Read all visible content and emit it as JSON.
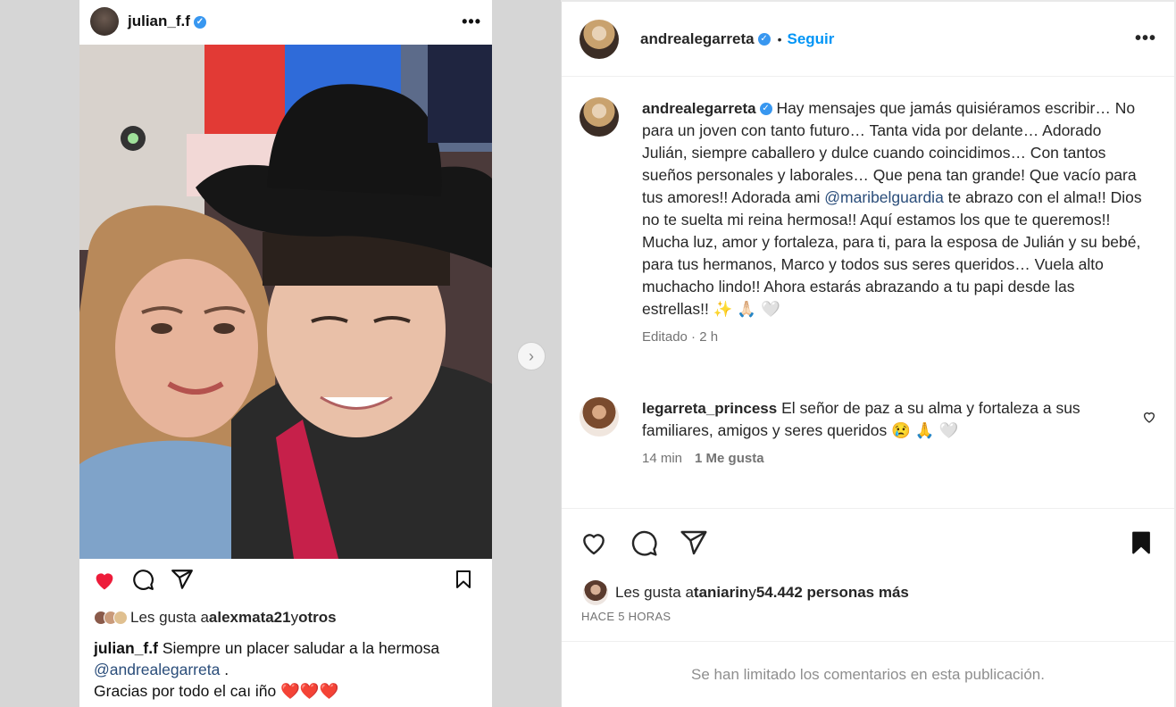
{
  "media": {
    "post_user": "julian_f.f",
    "likes_prefix": "Les gusta a ",
    "likes_user": "alexmata21",
    "likes_join": " y ",
    "likes_suffix": "otros",
    "caption_user": "julian_f.f",
    "caption_text": " Siempre un placer saludar a la hermosa",
    "caption_mention": "@andrealegarreta",
    "caption_after": " .",
    "caption_line3": "Gracias por todo el caı iño ❤️❤️❤️"
  },
  "header": {
    "username": "andrealegarreta",
    "follow": "Seguir"
  },
  "caption": {
    "username": "andrealegarreta",
    "text1": " Hay mensajes que jamás quisiéramos escribir… No para un joven con tanto futuro… Tanta vida por delante… Adorado Julián, siempre caballero y dulce cuando coincidimos… Con tantos sueños personales y laborales… Que pena tan grande! Que vacío para tus amores!! Adorada ami ",
    "mention": "@maribelguardia",
    "text2": " te abrazo con el alma!! Dios no te suelta mi reina hermosa!! Aquí estamos los que te queremos!! Mucha luz, amor y fortaleza, para ti, para la esposa de Julián y su bebé, para tus hermanos, Marco y todos sus seres queridos… Vuela alto muchacho lindo!! Ahora estarás abrazando a tu papi desde las estrellas!! ✨ 🙏🏻 🤍",
    "meta": "Editado · 2 h"
  },
  "comment": {
    "username": "legarreta_princess",
    "text": " El señor de paz a su alma y fortaleza a sus familiares, amigos y seres queridos 😢 🙏 🤍",
    "time": "14 min",
    "likes": "1 Me gusta"
  },
  "likes": {
    "prefix": "Les gusta a ",
    "user": "taniarin",
    "join": " y ",
    "count": "54.442 personas más"
  },
  "time_ago": "HACE 5 HORAS",
  "limited": "Se han limitado los comentarios en esta publicación."
}
